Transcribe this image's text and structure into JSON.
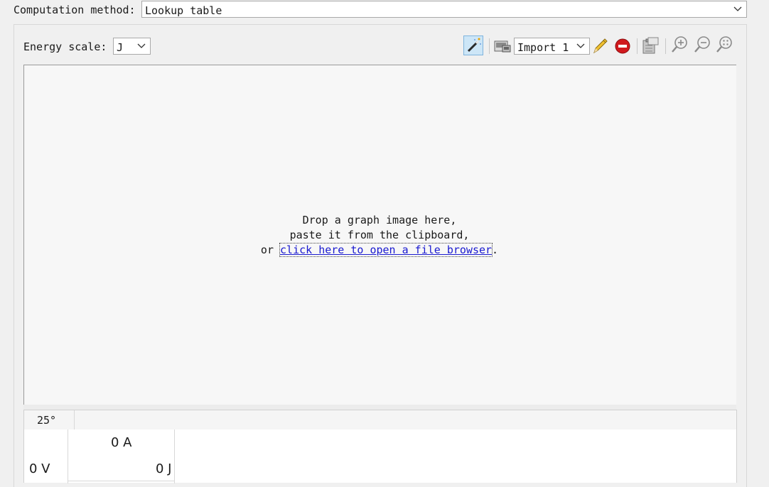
{
  "computation": {
    "label": "Computation method:",
    "value": "Lookup table"
  },
  "energy": {
    "label": "Energy scale:",
    "value": "J"
  },
  "toolbar": {
    "import_value": "Import 1",
    "icons": [
      "magic-wand-icon",
      "image-screen-icon",
      "pencil-icon",
      "delete-red-icon",
      "clipboard-icon",
      "zoom-in-icon",
      "zoom-out-icon",
      "zoom-fit-icon"
    ]
  },
  "canvas": {
    "line1": "Drop a graph image here,",
    "line2": "paste it from the clipboard,",
    "line3_prefix": "or ",
    "link_text": "click here to open a file browser",
    "line3_suffix": "."
  },
  "table": {
    "tab_label": "25°",
    "cell_a": "0 A",
    "cell_v": "0 V",
    "cell_j": "0 J"
  }
}
